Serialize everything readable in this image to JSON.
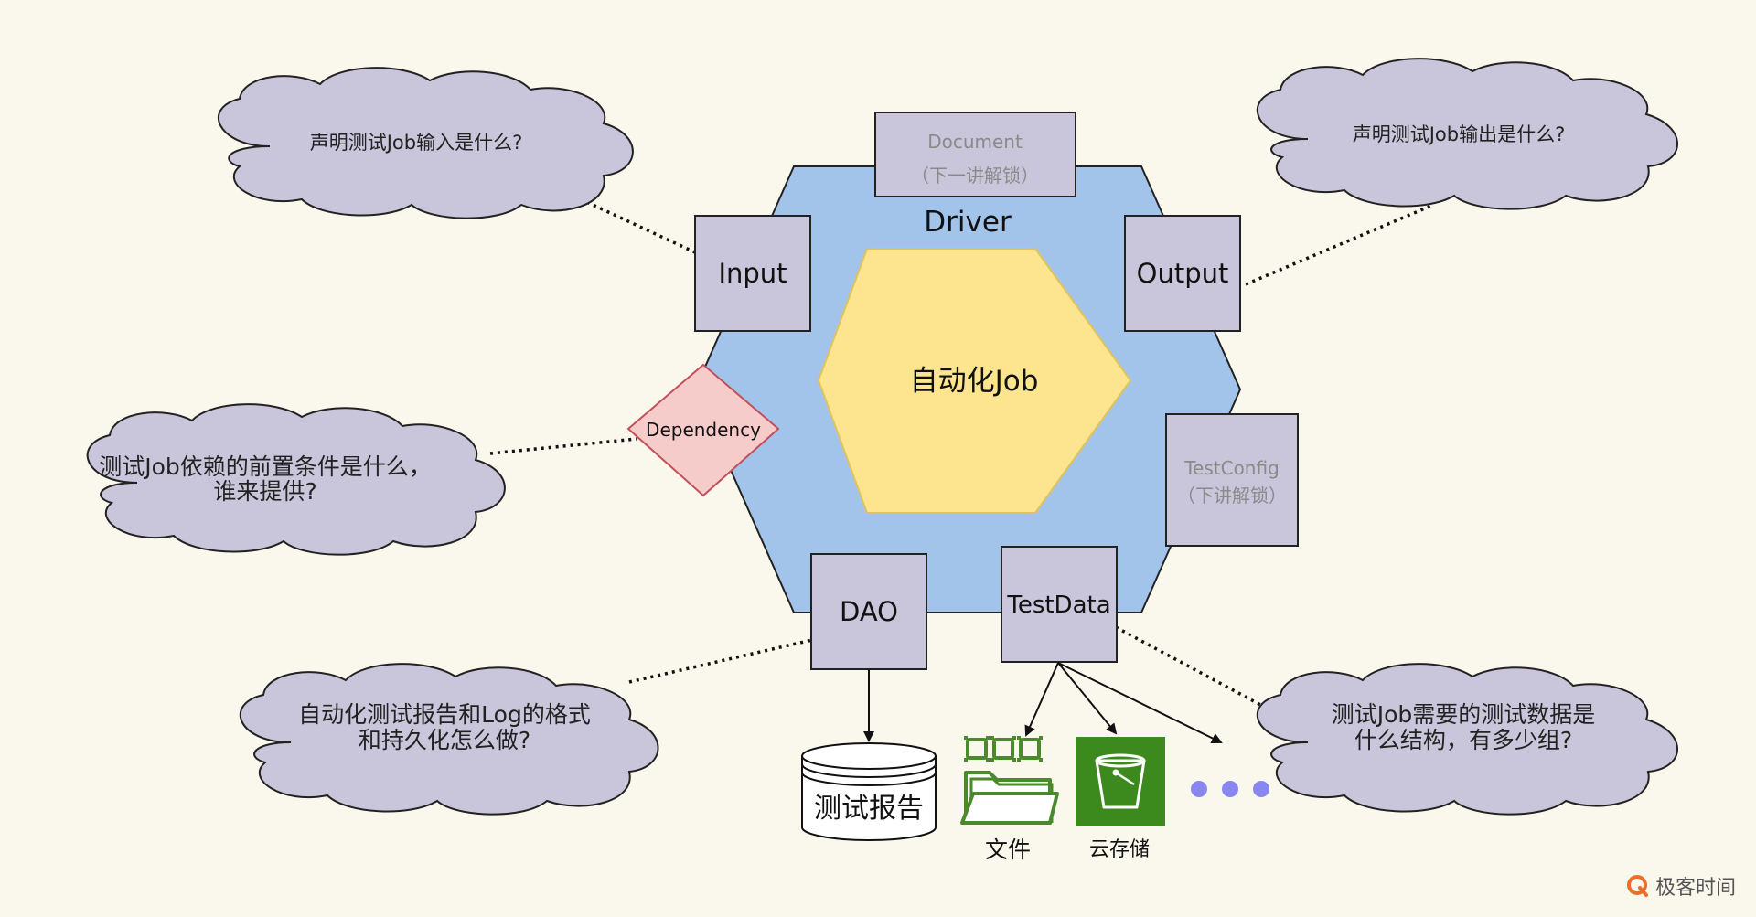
{
  "hexagon": {
    "outer_label": "Driver",
    "core_label": "自动化Job"
  },
  "ports": {
    "document": {
      "line1": "Document",
      "line2": "（下一讲解锁）"
    },
    "input": "Input",
    "output": "Output",
    "dependency": "Dependency",
    "testconfig": {
      "line1": "TestConfig",
      "line2": "（下讲解锁）"
    },
    "dao": "DAO",
    "testdata": "TestData"
  },
  "clouds": {
    "input_question": "声明测试Job输入是什么?",
    "output_question": "声明测试Job输出是什么?",
    "dependency_question": {
      "line1": "测试Job依赖的前置条件是什么，",
      "line2": "谁来提供?"
    },
    "dao_question": {
      "line1": "自动化测试报告和Log的格式",
      "line2": "和持久化怎么做?"
    },
    "testdata_question": {
      "line1": "测试Job需要的测试数据是",
      "line2": "什么结构，有多少组?"
    }
  },
  "outputs": {
    "report": "测试报告",
    "file": "文件",
    "cloud_storage": "云存储"
  },
  "brand": {
    "name": "极客时间"
  },
  "colors": {
    "background": "#faf7ec",
    "hexagon_fill": "#a3c4ea",
    "core_fill": "#fde58f",
    "port_fill": "#c9c5da",
    "cloud_fill": "#c9c5da",
    "dependency_fill": "#f6cccb",
    "dependency_stroke": "#c0505a",
    "file_green": "#4a8a2c",
    "storage_green": "#3c8a1e",
    "dots": "#8a86f0"
  },
  "icons": {
    "file": "folder-icon",
    "cloud_storage": "bucket-icon",
    "more": "ellipsis-icon"
  }
}
